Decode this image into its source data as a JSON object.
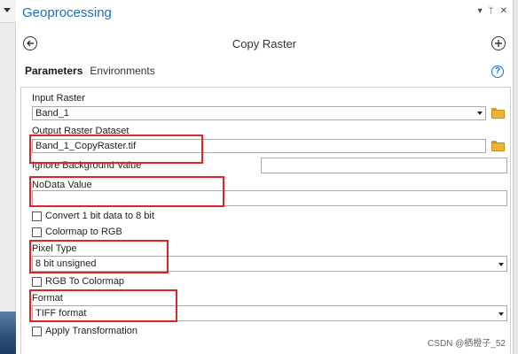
{
  "panel": {
    "title": "Geoprocessing",
    "controls": [
      "▾",
      "ᛘ",
      "✕"
    ]
  },
  "tool": {
    "title": "Copy Raster"
  },
  "tabs": [
    {
      "label": "Parameters",
      "active": true
    },
    {
      "label": "Environments",
      "active": false
    }
  ],
  "help": "?",
  "params": {
    "input_raster": {
      "label": "Input Raster",
      "value": "Band_1"
    },
    "output_dataset": {
      "label": "Output Raster Dataset",
      "value": "Band_1_CopyRaster.tif"
    },
    "ignore_bg": {
      "label": "Ignore Background Value",
      "value": ""
    },
    "nodata": {
      "label": "NoData Value",
      "value": ""
    },
    "convert_1bit": {
      "label": "Convert 1 bit data to 8 bit",
      "checked": false
    },
    "colormap_rgb": {
      "label": "Colormap to RGB",
      "checked": false
    },
    "pixel_type": {
      "label": "Pixel Type",
      "value": "8 bit unsigned"
    },
    "rgb_colormap": {
      "label": "RGB To Colormap",
      "checked": false
    },
    "format": {
      "label": "Format",
      "value": "TIFF format"
    },
    "apply_transform": {
      "label": "Apply Transformation",
      "checked": false
    }
  },
  "colors": {
    "accent": "#1d6db5",
    "highlight": "#e02424",
    "folder": "#e9b53a"
  },
  "watermark": "CSDN @栖橙子_52"
}
